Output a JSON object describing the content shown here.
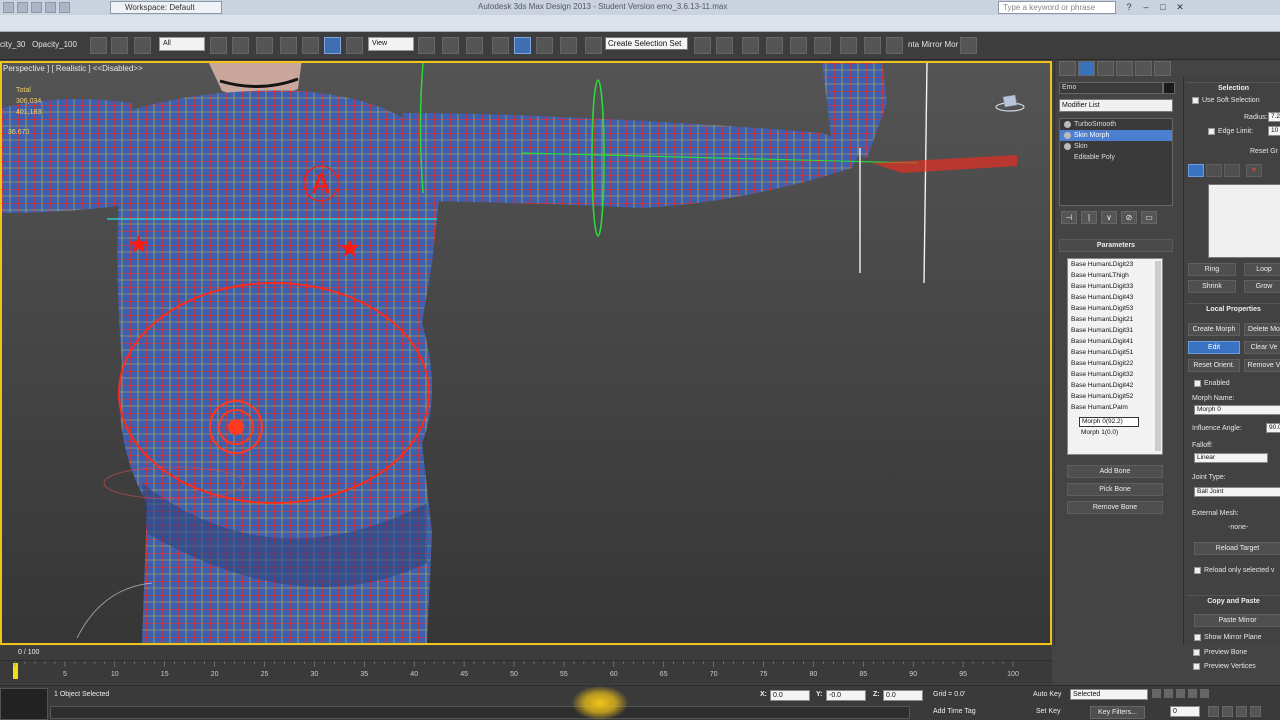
{
  "title_bar": {
    "workspace": "Workspace: Default",
    "app_title": "Autodesk 3ds Max Design 2013 - Student Version    emo_3.6.13-11.max",
    "search_placeholder": "Type a keyword or phrase"
  },
  "toolbar": {
    "opacity_left": "city_30",
    "opacity_right": "Opacity_100",
    "filter_value": "All",
    "ref_coord": "View",
    "create_selection_set": "Create Selection Set",
    "mirror_label": "nta Mirror Mor"
  },
  "viewport": {
    "label": "Perspective ] [ Realistic ] <<Disabled>>",
    "stats_total": "Total",
    "stats_polys": "306,034",
    "stats_verts": "401,183",
    "distance": "36.670"
  },
  "command_panel": {
    "object_name": "Emo",
    "modifier_list": "Modifier List",
    "stack": [
      {
        "label": "TurboSmooth",
        "selected": false
      },
      {
        "label": "Skin Morph",
        "selected": true
      },
      {
        "label": "Skin",
        "selected": false
      },
      {
        "label": "Editable Poly",
        "selected": false
      }
    ],
    "parameters_header": "Parameters",
    "bones": [
      "Base HumanLDigit23",
      "Base HumanLThigh",
      "Base HumanLDigit33",
      "Base HumanLDigit43",
      "Base HumanLDigit53",
      "Base HumanLDigit21",
      "Base HumanLDigit31",
      "Base HumanLDigit41",
      "Base HumanLDigit51",
      "Base HumanLDigit22",
      "Base HumanLDigit32",
      "Base HumanLDigit42",
      "Base HumanLDigit52",
      "Base HumanLPalm"
    ],
    "morph_popup_1": "Morph 0(92.2)",
    "morph_popup_2": "Morph 1(0.0)",
    "add_bone": "Add Bone",
    "pick_bone": "Pick Bone",
    "remove_bone": "Remove Bone"
  },
  "right_panel": {
    "selection_header": "Selection",
    "use_soft_selection": "Use Soft Selection",
    "radius_label": "Radius:",
    "radius_value": "7.2",
    "edge_limit_label": "Edge Limit:",
    "edge_limit_value": "10",
    "reset_graph": "Reset Gr",
    "ring": "Ring",
    "loop": "Loop",
    "shrink": "Shrink",
    "grow": "Grow",
    "local_properties_header": "Local Properties",
    "create_morph": "Create Morph",
    "delete_morph": "Delete Mo",
    "edit": "Edit",
    "clear_verts": "Clear Ve",
    "reset_orient": "Reset Orient.",
    "remove_verts": "Remove V",
    "enabled": "Enabled",
    "morph_name_label": "Morph Name:",
    "morph_name_value": "Morph 0",
    "influence_angle_label": "Influence Angle:",
    "influence_angle_value": "90.0",
    "falloff_label": "Falloff:",
    "falloff_value": "Linear",
    "joint_type_label": "Joint Type:",
    "joint_type_value": "Ball Joint",
    "external_mesh_label": "External Mesh:",
    "external_mesh_value": "-none-",
    "reload_target": "Reload Target",
    "reload_only_selected": "Reload only selected v",
    "copy_paste_header": "Copy and Paste",
    "paste_mirror": "Paste Mirror",
    "show_mirror_plane": "Show Mirror Plane",
    "preview_bone": "Preview Bone",
    "preview_vertices": "Preview Vertices"
  },
  "timeline": {
    "frame_indicator": "0 / 100",
    "ticks": [
      "5",
      "10",
      "15",
      "20",
      "25",
      "30",
      "35",
      "40",
      "45",
      "50",
      "55",
      "60",
      "65",
      "70",
      "75",
      "80",
      "85",
      "90",
      "95",
      "100"
    ],
    "current_frame": 0,
    "total_frames": 100
  },
  "status_bar": {
    "selection_text": "1 Object Selected",
    "x_label": "X:",
    "x_value": "0.0",
    "y_label": "Y:",
    "y_value": "-0.0",
    "z_label": "Z:",
    "z_value": "0.0",
    "grid": "Grid = 0.0'",
    "auto_key": "Auto Key",
    "selected_value": "Selected",
    "set_key": "Set Key",
    "key_filters": "Key Filters...",
    "add_time_tag": "Add Time Tag",
    "frame_value": "0"
  },
  "colors": {
    "viewport_border": "#f0c318",
    "mesh_fill": "#3c5fb0",
    "wire_red": "#ff2a1a",
    "wire_yellow": "#f5d21a",
    "selection_blue": "#4d7fd0"
  }
}
